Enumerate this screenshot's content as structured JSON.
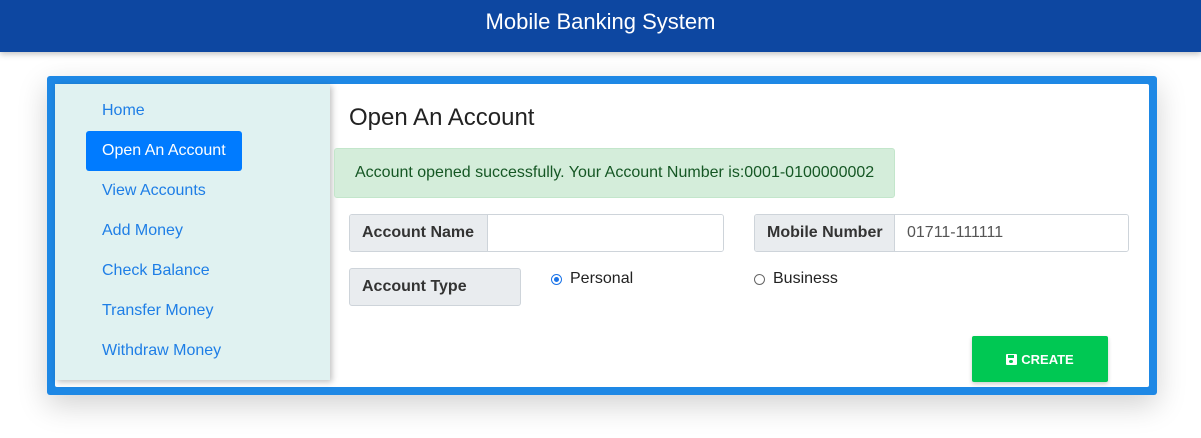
{
  "header": {
    "title": "Mobile Banking System"
  },
  "sidebar": {
    "items": [
      {
        "label": "Home",
        "active": false
      },
      {
        "label": "Open An Account",
        "active": true
      },
      {
        "label": "View Accounts",
        "active": false
      },
      {
        "label": "Add Money",
        "active": false
      },
      {
        "label": "Check Balance",
        "active": false
      },
      {
        "label": "Transfer Money",
        "active": false
      },
      {
        "label": "Withdraw Money",
        "active": false
      }
    ]
  },
  "main": {
    "title": "Open An Account",
    "alert": "Account opened successfully. Your Account Number is:0001-0100000002",
    "account_name": {
      "label": "Account Name",
      "value": "",
      "placeholder": ""
    },
    "mobile_number": {
      "label": "Mobile Number",
      "value": "",
      "placeholder": "01711-111111"
    },
    "account_type": {
      "label": "Account Type",
      "options": [
        {
          "label": "Personal",
          "checked": true
        },
        {
          "label": "Business",
          "checked": false
        }
      ]
    },
    "create_button": {
      "label": "CREATE",
      "icon": "save-icon"
    }
  },
  "colors": {
    "header_bg": "#0d47a1",
    "frame": "#1e88e5",
    "sidebar_bg": "#e0f2f1",
    "active_nav": "#007bff",
    "link": "#1e7ee6",
    "success_bg": "#d4edda",
    "success_text": "#155724",
    "create_button": "#00c853"
  }
}
